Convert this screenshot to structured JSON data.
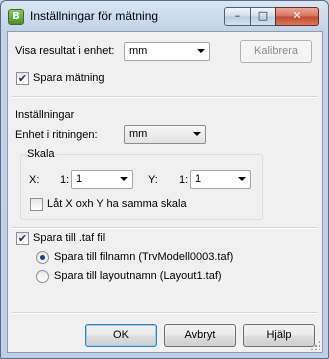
{
  "window": {
    "title": "Inställningar för mätning",
    "icon_letter": "B",
    "caption": {
      "minimize": "–",
      "maximize": "□",
      "close": "✕"
    }
  },
  "top": {
    "unit_label": "Visa resultat i enhet:",
    "unit_value": "mm",
    "calibrate_label": "Kalibrera",
    "save_measure_label": "Spara mätning",
    "save_measure_checked": true
  },
  "settings": {
    "group_title": "Inställningar",
    "drawing_unit_label": "Enhet i ritningen:",
    "drawing_unit_value": "mm",
    "scale": {
      "group_title": "Skala",
      "x_label": "X:",
      "x_prefix": "1:",
      "x_value": "1",
      "y_label": "Y:",
      "y_prefix": "1:",
      "y_value": "1",
      "same_scale_label": "Låt X oxh Y ha samma skala",
      "same_scale_checked": false
    }
  },
  "taf": {
    "save_taf_label": "Spara till .taf fil",
    "save_taf_checked": true,
    "options": [
      {
        "label": "Spara till filnamn  (TrvModell0003.taf)",
        "selected": true
      },
      {
        "label": "Spara till layoutnamn  (Layout1.taf)",
        "selected": false
      }
    ]
  },
  "buttons": {
    "ok": "OK",
    "cancel": "Avbryt",
    "help": "Hjälp"
  }
}
